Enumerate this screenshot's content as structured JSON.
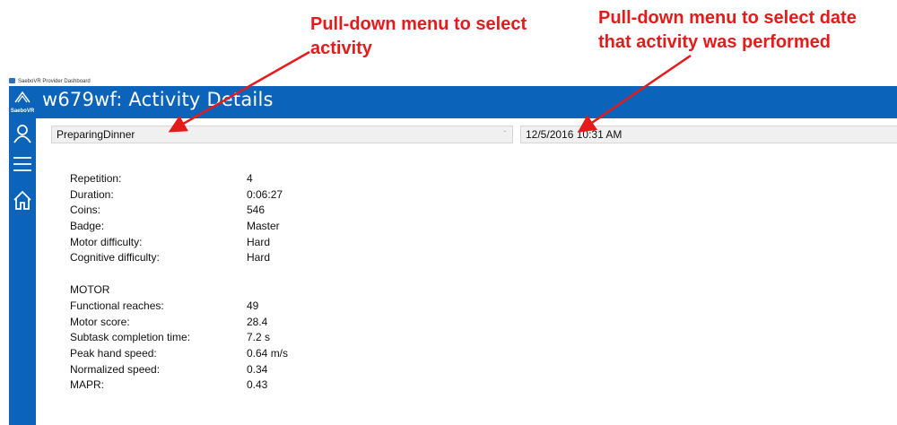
{
  "annotations": {
    "activity_note": "Pull-down menu to  select activity",
    "date_note": "Pull-down menu to select date that activity was performed",
    "color": "#e31b1b"
  },
  "window": {
    "title": "SaeboVR Provider Dashboard"
  },
  "header": {
    "logo_text": "SaeboVR",
    "title": "w679wf: Activity Details",
    "color": "#0b64b9"
  },
  "sidebar": {
    "icons": [
      "user-icon",
      "menu-icon",
      "home-icon"
    ]
  },
  "selectors": {
    "activity": "PreparingDinner",
    "date": "12/5/2016 10:31 AM"
  },
  "details": [
    {
      "label": "Repetition:",
      "value": "4"
    },
    {
      "label": "Duration:",
      "value": "0:06:27"
    },
    {
      "label": "Coins:",
      "value": "546"
    },
    {
      "label": "Badge:",
      "value": "Master"
    },
    {
      "label": "Motor difficulty:",
      "value": "Hard"
    },
    {
      "label": "Cognitive difficulty:",
      "value": "Hard"
    }
  ],
  "motor": {
    "heading": "MOTOR",
    "rows": [
      {
        "label": "Functional reaches:",
        "value": "49"
      },
      {
        "label": "Motor score:",
        "value": "28.4"
      },
      {
        "label": "Subtask completion time:",
        "value": "7.2 s"
      },
      {
        "label": "Peak hand speed:",
        "value": "0.64 m/s"
      },
      {
        "label": "Normalized speed:",
        "value": "0.34"
      },
      {
        "label": "MAPR:",
        "value": "0.43"
      }
    ]
  }
}
